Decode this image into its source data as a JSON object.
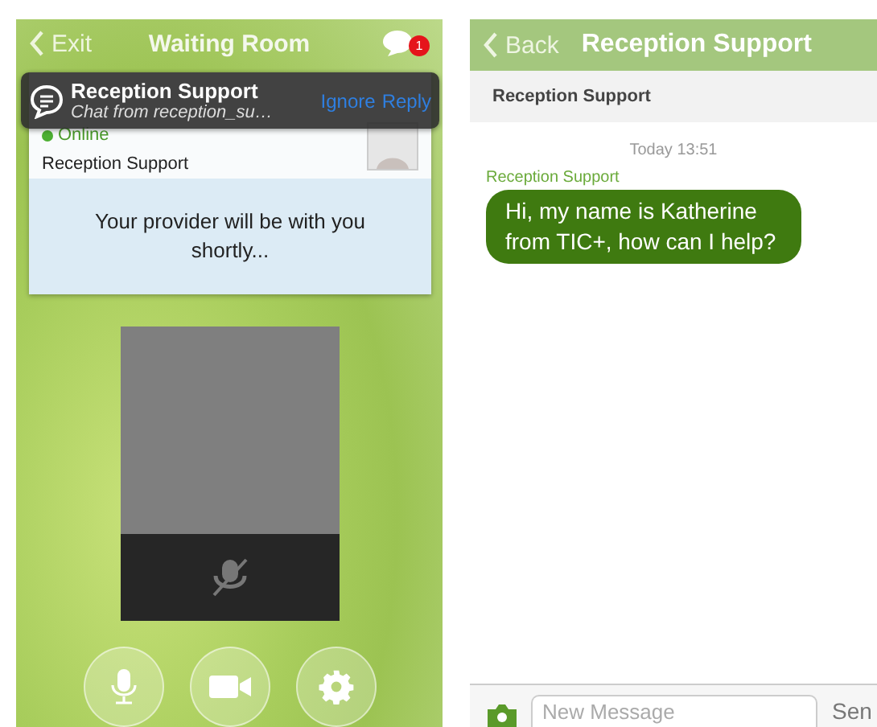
{
  "waiting_room": {
    "back": "Exit",
    "title": "Waiting Room",
    "chat_badge": "1",
    "status": {
      "label": "Online",
      "online": true
    },
    "provider": "Reception Support",
    "message": "Your provider will be with you shortly...",
    "mic_muted": true,
    "notification": {
      "title": "Reception Support",
      "subtitle": "Chat from reception_su…",
      "actions": [
        "Ignore",
        "Reply"
      ]
    }
  },
  "chat": {
    "back": "Back",
    "title": "Reception Support",
    "contact": "Reception Support",
    "messages": [
      {
        "time": "Today 13:51",
        "sender": "Reception Support",
        "text": "Hi, my name is Katherine from TIC+, how can I help?"
      }
    ],
    "compose": {
      "placeholder": "New Message",
      "send": "Sen"
    }
  }
}
